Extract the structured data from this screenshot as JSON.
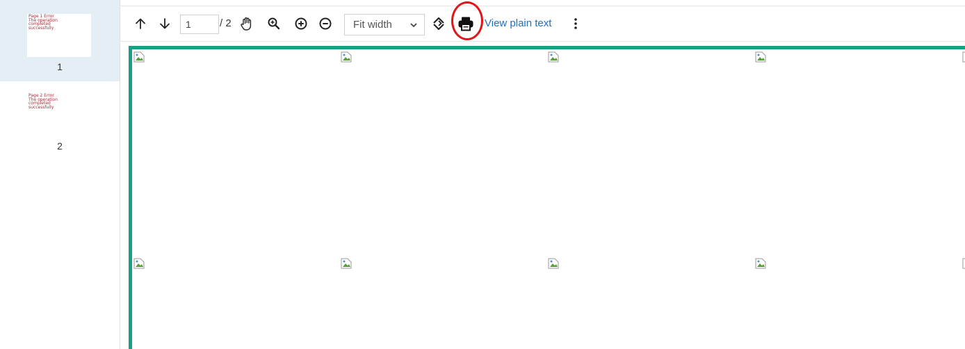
{
  "sidebar": {
    "thumbnails": [
      {
        "page_label": "1",
        "preview_text": "Page 1 Error\nThe operation\ncompleted\nsuccessfully"
      },
      {
        "page_label": "2",
        "preview_text": "Page 2 Error\nThe operation\ncompleted\nsuccessfully"
      }
    ]
  },
  "toolbar": {
    "current_page": "1",
    "page_total": "/ 2",
    "zoom_value": "Fit width",
    "view_plain_text_label": "View plain text",
    "icons": [
      "arrow-up-icon",
      "arrow-down-icon",
      "hand-icon",
      "zoom-search-icon",
      "zoom-in-icon",
      "zoom-out-icon",
      "rotate-icon",
      "print-icon",
      "more-vertical-icon"
    ]
  },
  "colors": {
    "accent_border": "#17a084",
    "link": "#1f6fc0",
    "highlight": "#e0161b",
    "active_thumb_bg": "#e3eef5"
  }
}
